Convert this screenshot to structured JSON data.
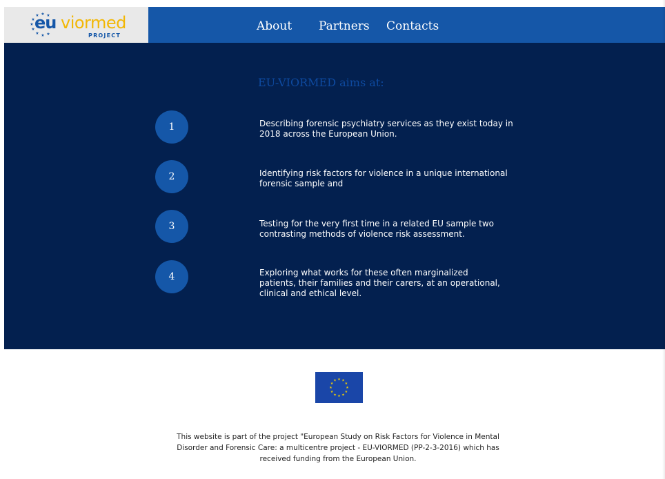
{
  "header": {
    "logo": {
      "eu": "eu",
      "viormed": "viormed",
      "project": "PROJECT"
    },
    "nav": [
      {
        "label": "About"
      },
      {
        "label": "Partners"
      },
      {
        "label": "Contacts"
      }
    ]
  },
  "main": {
    "title": "EU-VIORMED aims at:",
    "items": [
      {
        "number": "1",
        "text": "Describing forensic psychiatry services as they exist today in 2018 across the European Union."
      },
      {
        "number": "2",
        "text": "Identifying risk factors for violence in a unique international forensic sample and"
      },
      {
        "number": "3",
        "text": "Testing for the very first time in a related EU sample two contrasting methods of violence risk assessment."
      },
      {
        "number": "4",
        "text": "Exploring what works for these often marginalized patients, their families and their carers, at an operational, clinical and ethical level."
      }
    ]
  },
  "footer": {
    "text": "This website is part of the project \"European Study on Risk Factors for Violence in Mental Disorder and Forensic Care: a multicentre project - EU-VIORMED (PP-2-3-2016) which has received funding from the European Union.",
    "flag_icon": "eu-flag-icon"
  },
  "colors": {
    "header_blue": "#1557a8",
    "main_navy": "#03204f",
    "accent_yellow": "#f2b705",
    "title_blue": "#0e4aa0"
  }
}
